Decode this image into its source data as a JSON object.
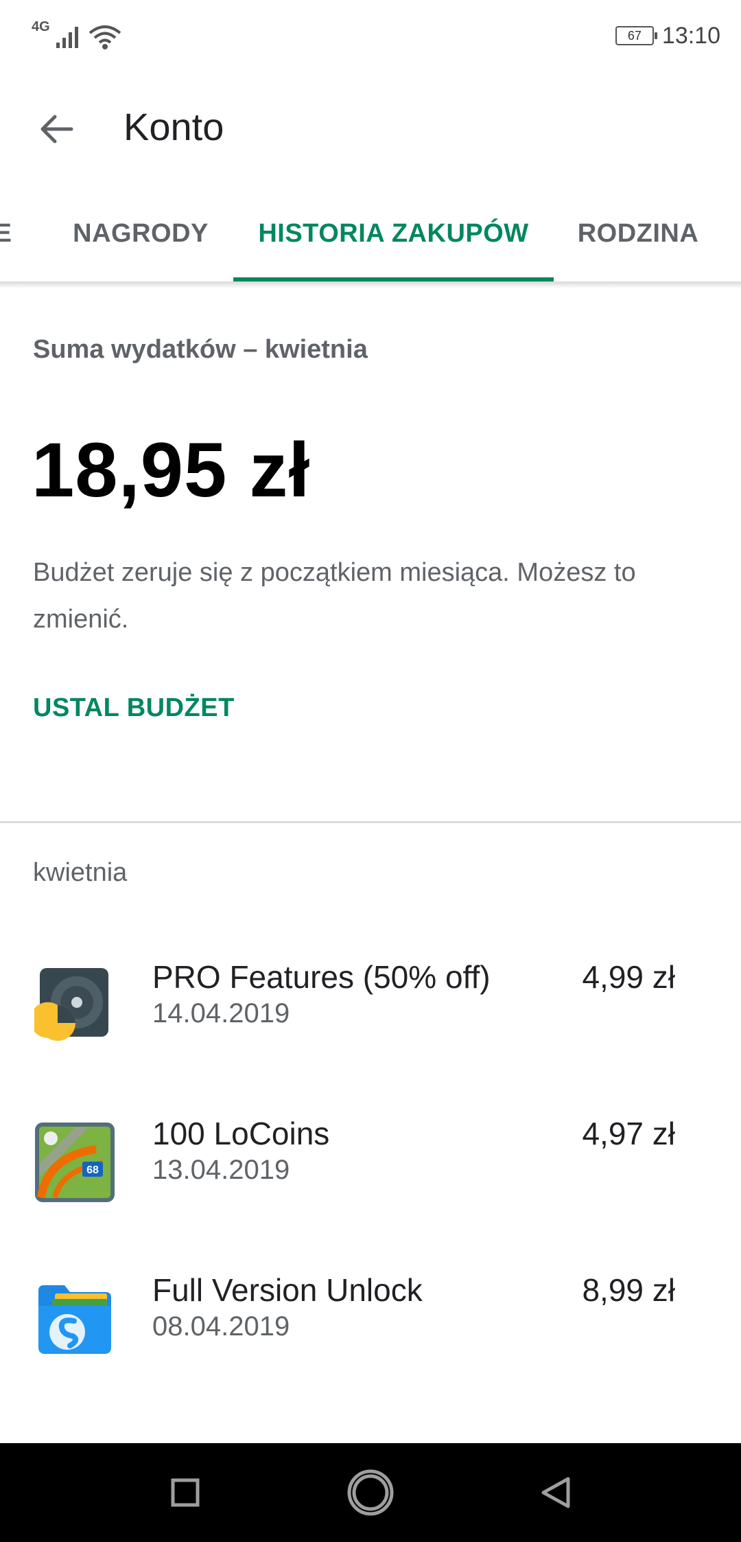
{
  "status_bar": {
    "network": "4G",
    "battery": "67",
    "time": "13:10"
  },
  "app_bar": {
    "title": "Konto"
  },
  "tabs": [
    {
      "label": "JE",
      "active": false
    },
    {
      "label": "NAGRODY",
      "active": false
    },
    {
      "label": "HISTORIA ZAKUPÓW",
      "active": true
    },
    {
      "label": "RODZINA",
      "active": false
    }
  ],
  "summary": {
    "label": "Suma wydatków – kwietnia",
    "amount": "18,95 zł",
    "description": "Budżet zeruje się z początkiem miesiąca. Możesz to zmienić.",
    "set_budget_label": "USTAL BUDŻET"
  },
  "history": {
    "month_label": "kwietnia",
    "items": [
      {
        "name": "PRO Features (50% off)",
        "date": "14.04.2019",
        "price": "4,99 zł",
        "icon": "analytics-app-icon"
      },
      {
        "name": "100 LoCoins",
        "date": "13.04.2019",
        "price": "4,97 zł",
        "icon": "locus-map-app-icon"
      },
      {
        "name": "Full Version Unlock",
        "date": "08.04.2019",
        "price": "8,99 zł",
        "icon": "file-manager-app-icon"
      }
    ]
  },
  "colors": {
    "accent": "#01875f",
    "text_primary": "#202124",
    "text_secondary": "#5f6368"
  }
}
